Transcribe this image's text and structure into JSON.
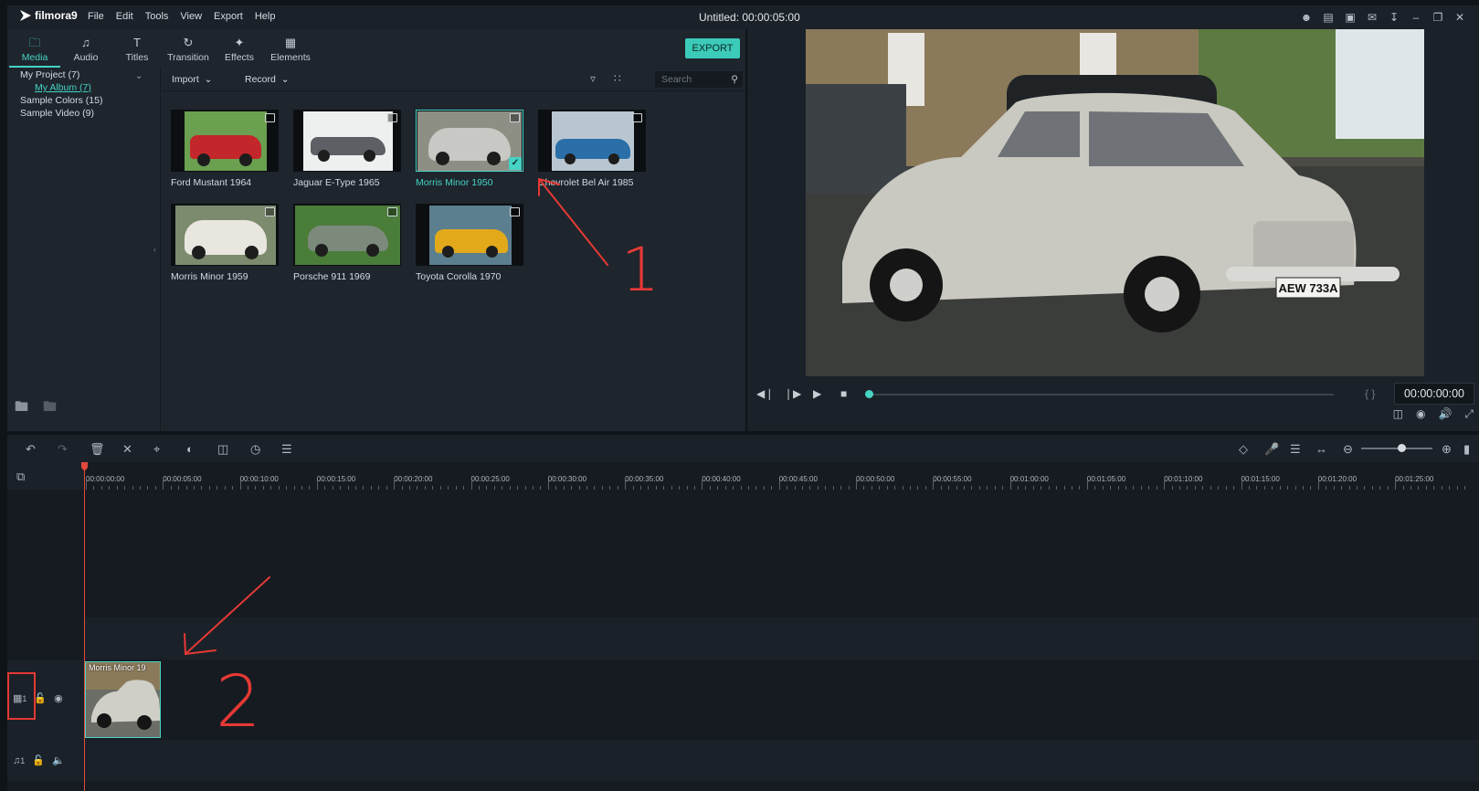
{
  "app": {
    "logo": "filmora9",
    "menu": [
      "File",
      "Edit",
      "Tools",
      "View",
      "Export",
      "Help"
    ],
    "doc_title": "Untitled:",
    "doc_duration": "00:00:05:00",
    "window_icons": [
      "user-icon",
      "cart-icon",
      "save-icon",
      "mail-icon",
      "download-icon",
      "minimize-icon",
      "restore-icon",
      "close-icon"
    ]
  },
  "library": {
    "tabs": [
      {
        "label": "Media",
        "icon": "folder-icon",
        "active": true
      },
      {
        "label": "Audio",
        "icon": "music-note-icon"
      },
      {
        "label": "Titles",
        "icon": "text-icon"
      },
      {
        "label": "Transition",
        "icon": "transition-icon"
      },
      {
        "label": "Effects",
        "icon": "effects-icon"
      },
      {
        "label": "Elements",
        "icon": "image-icon"
      }
    ],
    "export_label": "EXPORT",
    "tree": {
      "project": "My Project (7)",
      "album": "My Album (7)",
      "sample_colors": "Sample Colors (15)",
      "sample_video": "Sample Video (9)"
    },
    "toolbar": {
      "import_label": "Import",
      "record_label": "Record",
      "search_placeholder": "Search"
    },
    "media": [
      {
        "label": "Ford Mustant 1964",
        "color": "#c3262b"
      },
      {
        "label": "Jaguar E-Type 1965",
        "color": "#5c5f63"
      },
      {
        "label": "Morris Minor 1950",
        "color": "#b9b9b6",
        "selected": true
      },
      {
        "label": "Chevrolet Bel Air 1985",
        "color": "#2a6fa8"
      },
      {
        "label": "Morris Minor 1959",
        "color": "#e9e6df"
      },
      {
        "label": "Porsche 911 1969",
        "color": "#3f7a3d"
      },
      {
        "label": "Toyota Corolla 1970",
        "color": "#e2a91b"
      }
    ]
  },
  "preview": {
    "timecode": "00:00:00:00",
    "plate": "AEW 733A",
    "progress": 0
  },
  "timeline": {
    "ruler_labels": [
      "00:00:00:00",
      "00:00:05:00",
      "00:00:10:00",
      "00:00:15:00",
      "00:00:20:00",
      "00:00:25:00",
      "00:00:30:00",
      "00:00:35:00",
      "00:00:40:00",
      "00:00:45:00",
      "00:00:50:00",
      "00:00:55:00",
      "00:01:00:00",
      "00:01:05:00",
      "00:01:10:00",
      "00:01:15:00",
      "00:01:20:00",
      "00:01:25:00"
    ],
    "video_track_num": "1",
    "audio_track_num": "1",
    "clip_label": "Morris Minor 19"
  },
  "annotations": {
    "step1": "1",
    "step2": "2",
    "color": "#e53935"
  }
}
